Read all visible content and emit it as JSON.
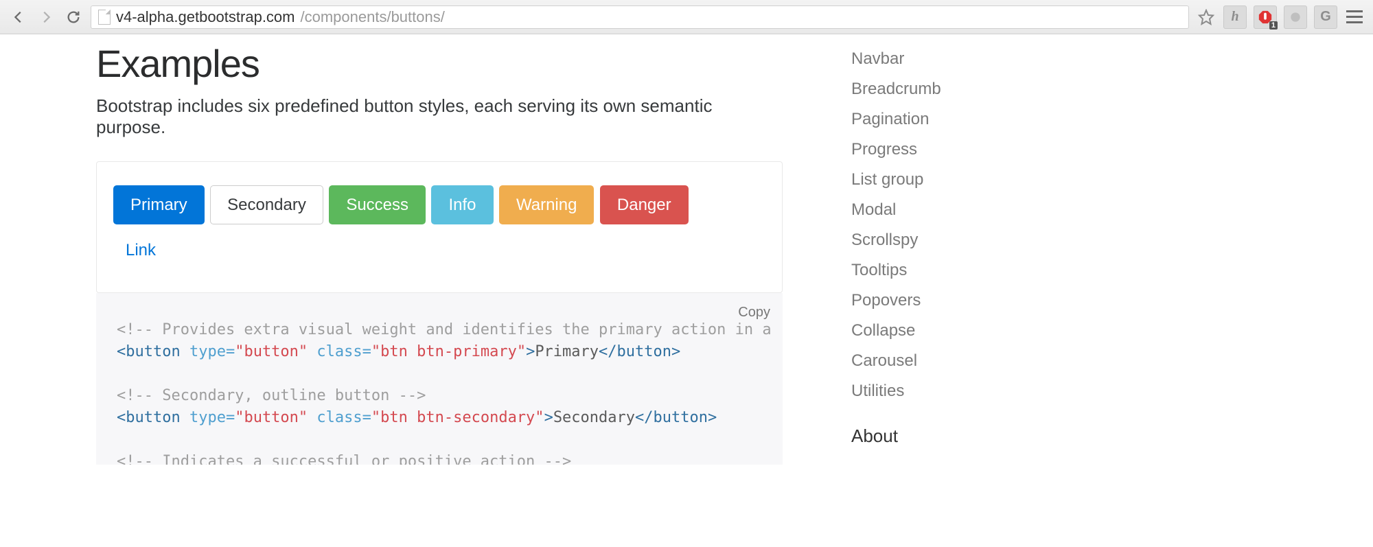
{
  "browser": {
    "url_host": "v4-alpha.getbootstrap.com",
    "url_path": "/components/buttons/",
    "extensions": {
      "honey": "h",
      "adblock_badge": "1",
      "g": "G"
    }
  },
  "main": {
    "heading": "Examples",
    "lead": "Bootstrap includes six predefined button styles, each serving its own semantic purpose.",
    "buttons": {
      "primary": "Primary",
      "secondary": "Secondary",
      "success": "Success",
      "info": "Info",
      "warning": "Warning",
      "danger": "Danger",
      "link": "Link"
    },
    "copy": "Copy",
    "code": {
      "comment1": "<!-- Provides extra visual weight and identifies the primary action in a",
      "line1_open": "<button",
      "line1_attr_type": " type=",
      "line1_val_type": "\"button\"",
      "line1_attr_class": " class=",
      "line1_val_class_primary": "\"btn btn-primary\"",
      "line1_gt": ">",
      "line1_text": "Primary",
      "line1_close": "</button>",
      "comment2": "<!-- Secondary, outline button -->",
      "line2_val_class_secondary": "\"btn btn-secondary\"",
      "line2_text": "Secondary",
      "comment3": "<!-- Indicates a successful or positive action -->"
    }
  },
  "sidebar": {
    "items": [
      "Navbar",
      "Breadcrumb",
      "Pagination",
      "Progress",
      "List group",
      "Modal",
      "Scrollspy",
      "Tooltips",
      "Popovers",
      "Collapse",
      "Carousel",
      "Utilities"
    ],
    "heading": "About"
  }
}
